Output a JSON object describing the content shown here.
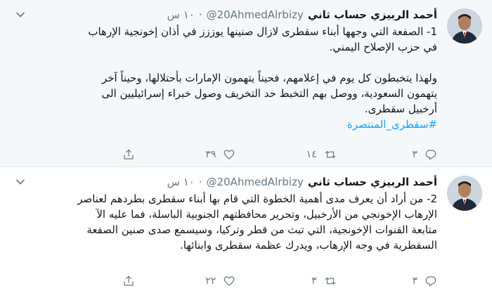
{
  "tweets": [
    {
      "author_name": "أحمد الربيزي حساب ثاني",
      "handle": "@20AhmedAlrbizy",
      "dot": "·",
      "time": "١٠ س",
      "lines": [
        "1- الصفعة التي وجهها أبناء سقطرى لازال صنينها يوززز في أذان إخونجية الإرهاب",
        "في حزب الإصلاح اليمني.",
        "",
        "ولهذا يتخبطون كل يوم في إعلامهم، فحيناً يتهمون الإمارات بأحتلالها، وحيناً آخر",
        "يتهمون السعودية، ووصل بهم التخبط حد التخريف وصول خبراء إسرائيليين الى",
        "أرخبيل سقطرى."
      ],
      "hashtag": "#سقطرى_المنتصرة",
      "replies": "٣",
      "retweets": "١٤",
      "likes": "٣٩"
    },
    {
      "author_name": "أحمد الربيزي حساب ثاني",
      "handle": "@20AhmedAlrbizy",
      "dot": "·",
      "time": "١٠ س",
      "lines": [
        "2- من أراد أن يعرف مدى أهمية الخطوة التي قام بها أبناء سقطرى بطردهم لعناصر",
        "الإرهاب الإخونجي من الأرخبيل، وتحرير محافظتهم الجنوبية الباسلة، فما عليه الآ",
        "متابعة القنوات الإخونجية، التي تبث من قطر وتركيا، وسيسمع صدى صنين الصفعة",
        "السقطرية في وجه الإرهاب، ويدرك عظمة سقطرى وابنائها."
      ],
      "replies": "٣",
      "retweets": "٣",
      "likes": "٢٢"
    }
  ],
  "colors": {
    "accent": "#1da1f2",
    "muted": "#657786",
    "highlight_bg": "#f5f8fa"
  },
  "icons": [
    "reply-icon",
    "retweet-icon",
    "like-icon",
    "share-icon",
    "chevron-down-icon"
  ]
}
